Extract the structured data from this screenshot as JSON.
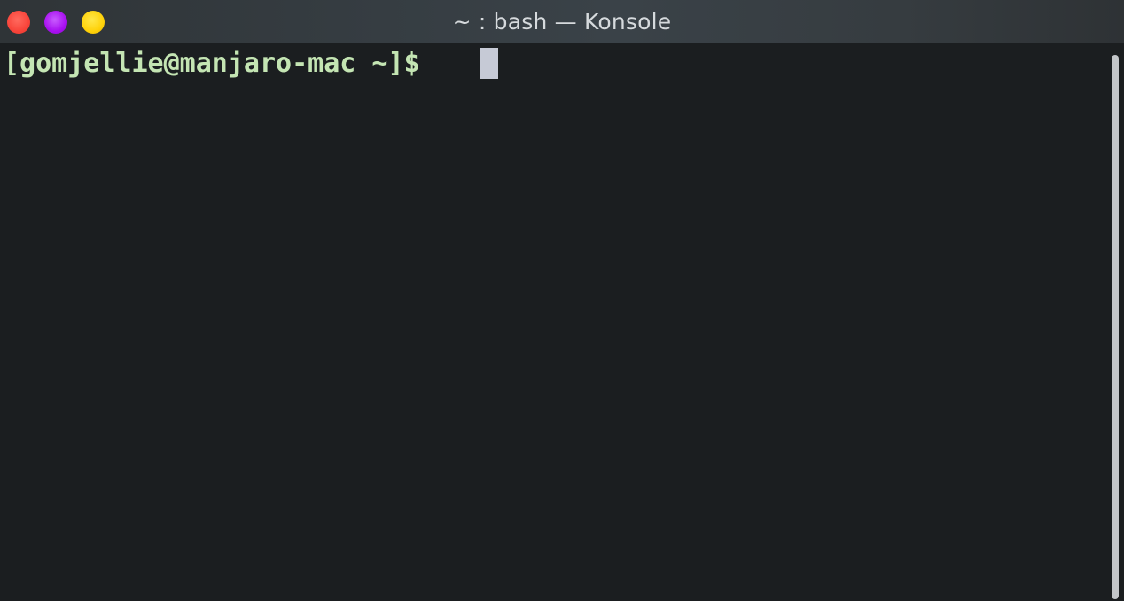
{
  "window": {
    "title": "~ : bash — Konsole",
    "buttons": {
      "close": "close-icon",
      "minimize": "minimize-icon",
      "maximize": "maximize-icon"
    }
  },
  "terminal": {
    "prompt": "[gomjellie@manjaro-mac ~]$ ",
    "prompt_color": "#c4e5b3",
    "background_color": "#1b1e20",
    "cursor_color": "#c6cad6"
  }
}
